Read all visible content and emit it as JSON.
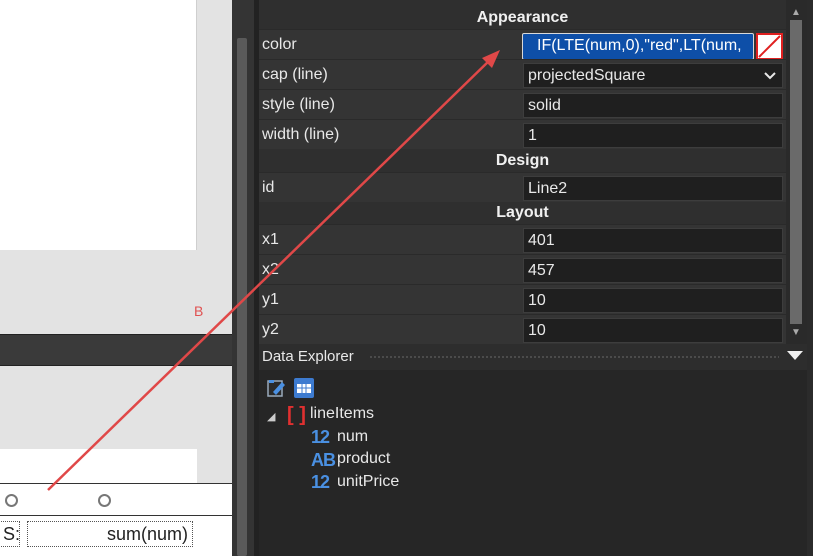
{
  "canvas": {
    "marker_text": "B",
    "footer_left_text": "S:",
    "footer_sum_text": "sum(num)"
  },
  "properties": {
    "groups": {
      "appearance": "Appearance",
      "design": "Design",
      "layout": "Layout"
    },
    "rows": {
      "color": {
        "name": "color",
        "value": "IF(LTE(num,0),\"red\",LT(num,"
      },
      "cap": {
        "name": "cap (line)",
        "value": "projectedSquare"
      },
      "style": {
        "name": "style (line)",
        "value": "solid"
      },
      "width": {
        "name": "width (line)",
        "value": "1"
      },
      "id": {
        "name": "id",
        "value": "Line2"
      },
      "x1": {
        "name": "x1",
        "value": "401"
      },
      "x2": {
        "name": "x2",
        "value": "457"
      },
      "y1": {
        "name": "y1",
        "value": "10"
      },
      "y2": {
        "name": "y2",
        "value": "10"
      }
    }
  },
  "data_explorer": {
    "title": "Data Explorer",
    "root": {
      "label": "lineItems",
      "icon": "array-brackets-icon"
    },
    "fields": [
      {
        "type_label": "12",
        "name": "num"
      },
      {
        "type_label": "AB",
        "name": "product"
      },
      {
        "type_label": "12",
        "name": "unitPrice"
      }
    ]
  },
  "colors": {
    "accent_blue": "#0e4fa8",
    "annotation_red": "#e04848",
    "panel_bg": "#2f2f2f"
  }
}
